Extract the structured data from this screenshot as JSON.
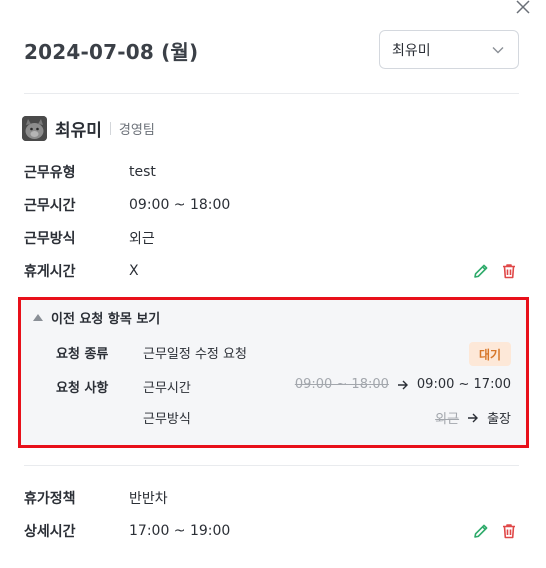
{
  "header": {
    "date_title": "2024-07-08 (월)",
    "select_value": "최유미"
  },
  "profile": {
    "name": "최유미",
    "team": "경영팀"
  },
  "schedule": {
    "rows": [
      {
        "key": "근무유형",
        "value": "test"
      },
      {
        "key": "근무시간",
        "value": "09:00 ~ 18:00"
      },
      {
        "key": "근무방식",
        "value": "외근"
      },
      {
        "key": "휴게시간",
        "value": "X"
      }
    ]
  },
  "request": {
    "toggle_label": "이전 요청 항목 보기",
    "type_key": "요청 종류",
    "type_value": "근무일정 수정 요청",
    "status_badge": "대기",
    "items_key": "요청 사항",
    "items": [
      {
        "label": "근무시간",
        "old": "09:00 ~ 18:00",
        "new": "09:00 ~ 17:00"
      },
      {
        "label": "근무방식",
        "old": "외근",
        "new": "출장"
      }
    ]
  },
  "leave": {
    "rows": [
      {
        "key": "휴가정책",
        "value": "반반차"
      },
      {
        "key": "상세시간",
        "value": "17:00 ~ 19:00"
      }
    ]
  },
  "colors": {
    "highlight_border": "#e8101a",
    "edit_icon": "#2eaa6a",
    "delete_icon": "#e04848",
    "badge_bg": "#fde8d8",
    "badge_text": "#d7772a"
  },
  "icons": [
    "close-icon",
    "chevron-down-icon",
    "edit-pencil-icon",
    "trash-icon",
    "triangle-up-icon",
    "arrow-right-icon"
  ]
}
